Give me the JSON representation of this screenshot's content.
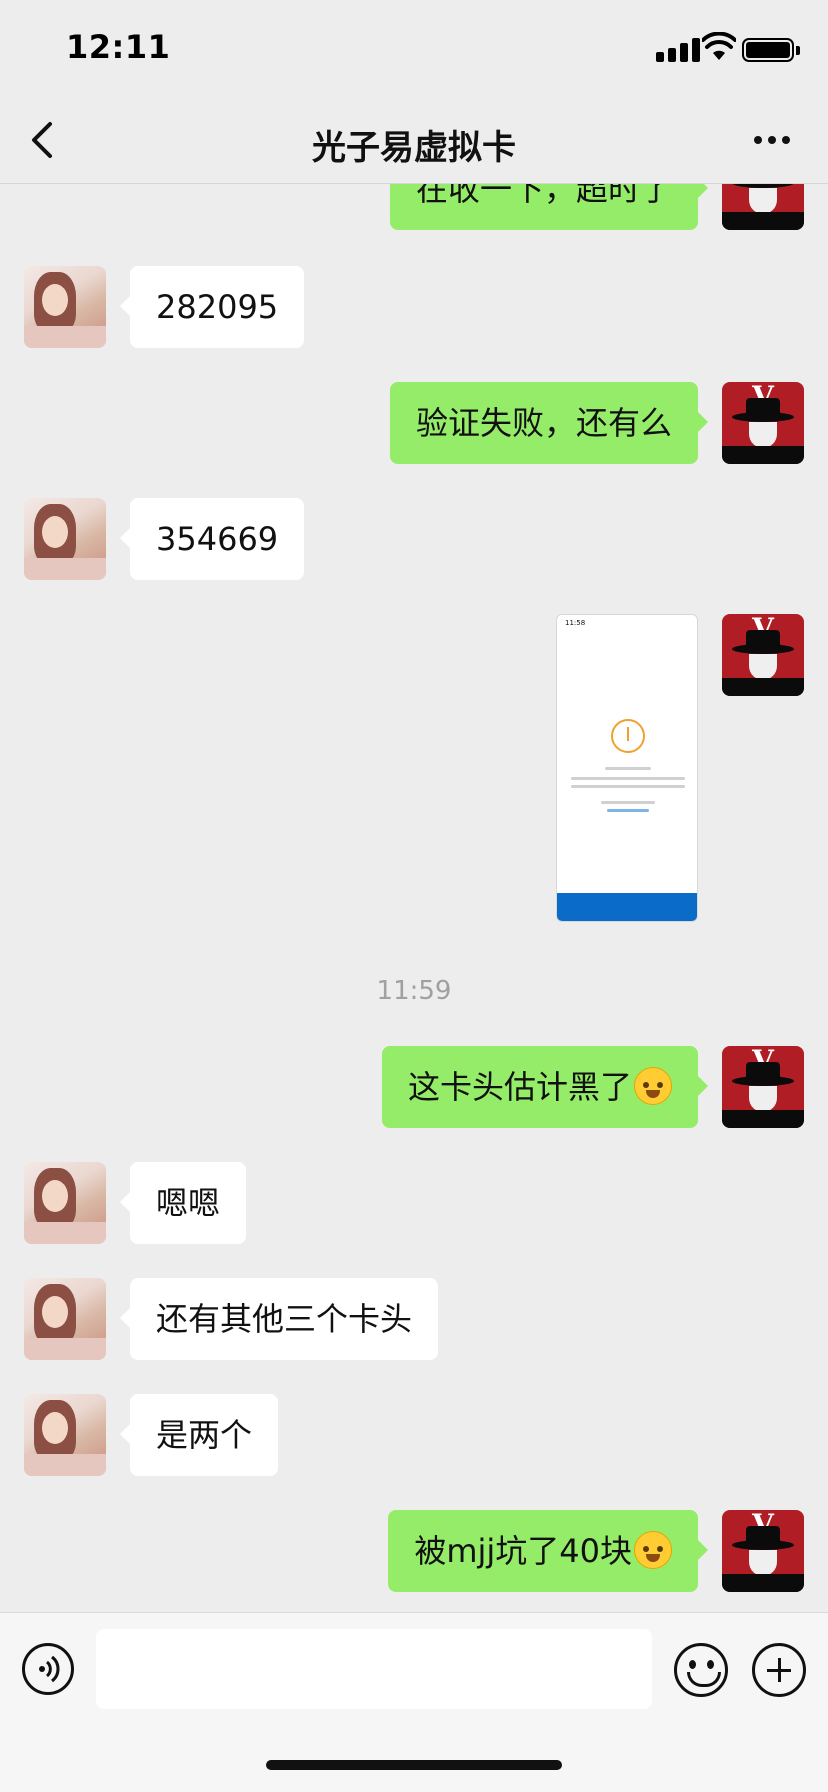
{
  "status": {
    "time": "12:11"
  },
  "header": {
    "title": "光子易虚拟卡"
  },
  "messages": {
    "m0": "在收一下，超时了",
    "m1": "282095",
    "m2": "验证失败，还有么",
    "m3": "354669",
    "time_divider": "11:59",
    "m5": "这卡头估计黑了",
    "m6": "嗯嗯",
    "m7": "还有其他三个卡头",
    "m8": "是两个",
    "m9": "被mjj坑了40块"
  },
  "screenshot_image": {
    "time": "11:58"
  },
  "input": {
    "value": ""
  },
  "icons": {
    "back": "chevron-left-icon",
    "more": "more-dots-icon",
    "voice": "voice-icon",
    "emoji": "emoji-icon",
    "plus": "plus-icon",
    "laughing_tears": "laughing-tears-emoji",
    "crying": "crying-emoji"
  },
  "colors": {
    "outgoing_bubble": "#95ec69",
    "incoming_bubble": "#ffffff",
    "background": "#ededed"
  }
}
